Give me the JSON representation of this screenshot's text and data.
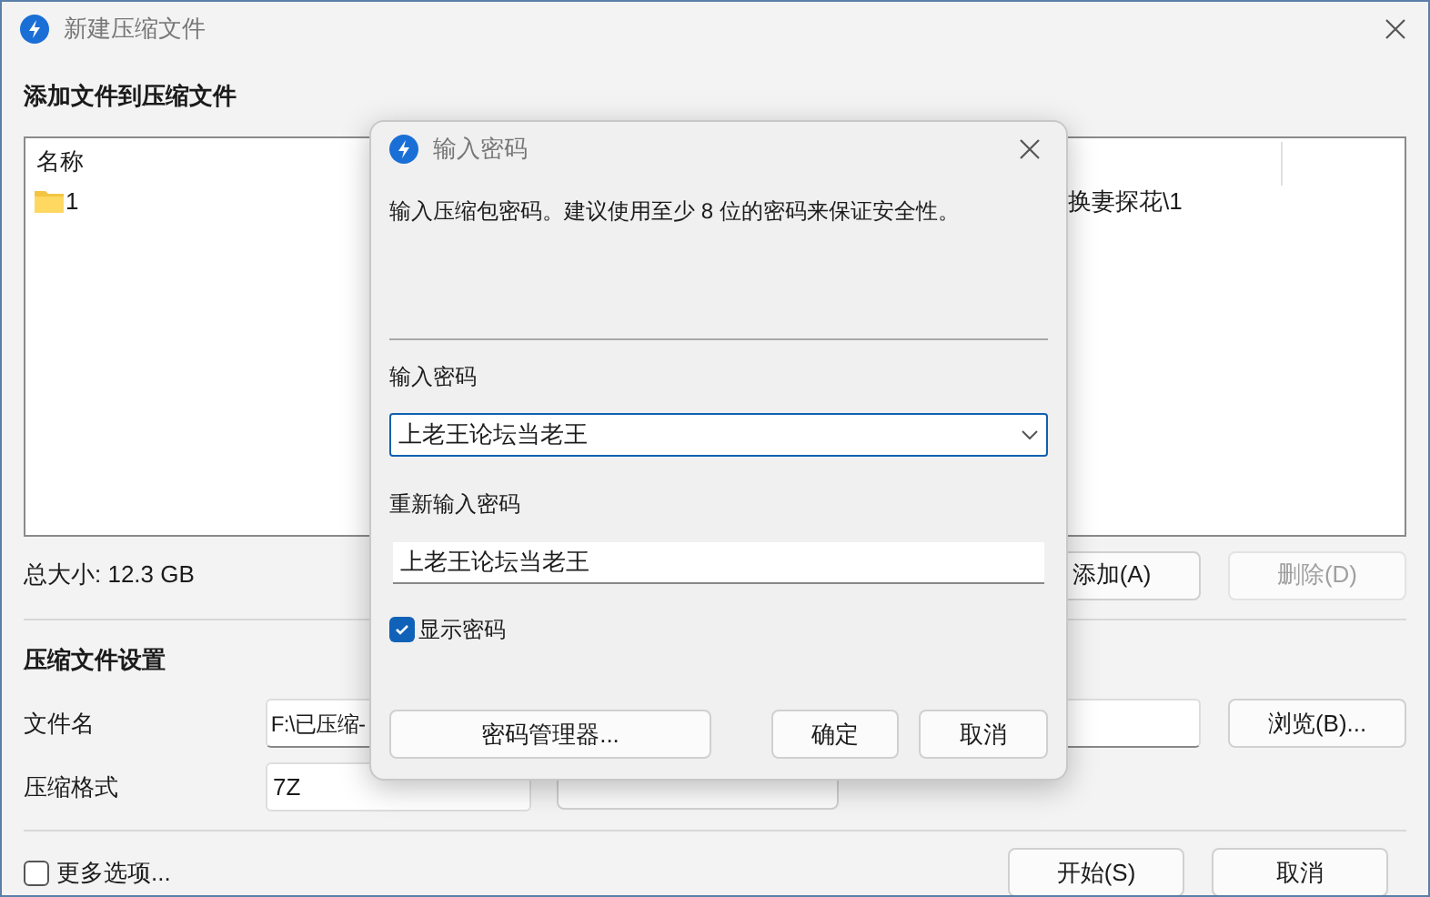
{
  "window": {
    "title": "新建压缩文件"
  },
  "add_section": {
    "heading": "添加文件到压缩文件",
    "columns": [
      "名称"
    ],
    "rows": [
      {
        "name": "1",
        "path": "换妻探花\\1"
      }
    ],
    "total_size": "总大小: 12.3 GB",
    "buttons": [
      {
        "label": "添加(A)",
        "disabled": false
      },
      {
        "label": "删除(D)",
        "disabled": true
      }
    ]
  },
  "settings": {
    "heading": "压缩文件设置",
    "filename_label": "文件名",
    "filename": "F:\\已压缩-",
    "browse": "浏览(B)...",
    "format_label": "压缩格式",
    "format": "7Z"
  },
  "more_options": {
    "label": "更多选项...",
    "checked": false
  },
  "footer_buttons": [
    "开始(S)",
    "取消"
  ],
  "dialog": {
    "title": "输入密码",
    "message": "输入压缩包密码。建议使用至少 8 位的密码来保证安全性。",
    "password_label": "输入密码",
    "password": "上老王论坛当老王",
    "confirm_label": "重新输入密码",
    "confirm": "上老王论坛当老王",
    "show_password": {
      "label": "显示密码",
      "checked": true
    },
    "manager_button": "密码管理器...",
    "ok_button": "确定",
    "cancel_button": "取消"
  }
}
